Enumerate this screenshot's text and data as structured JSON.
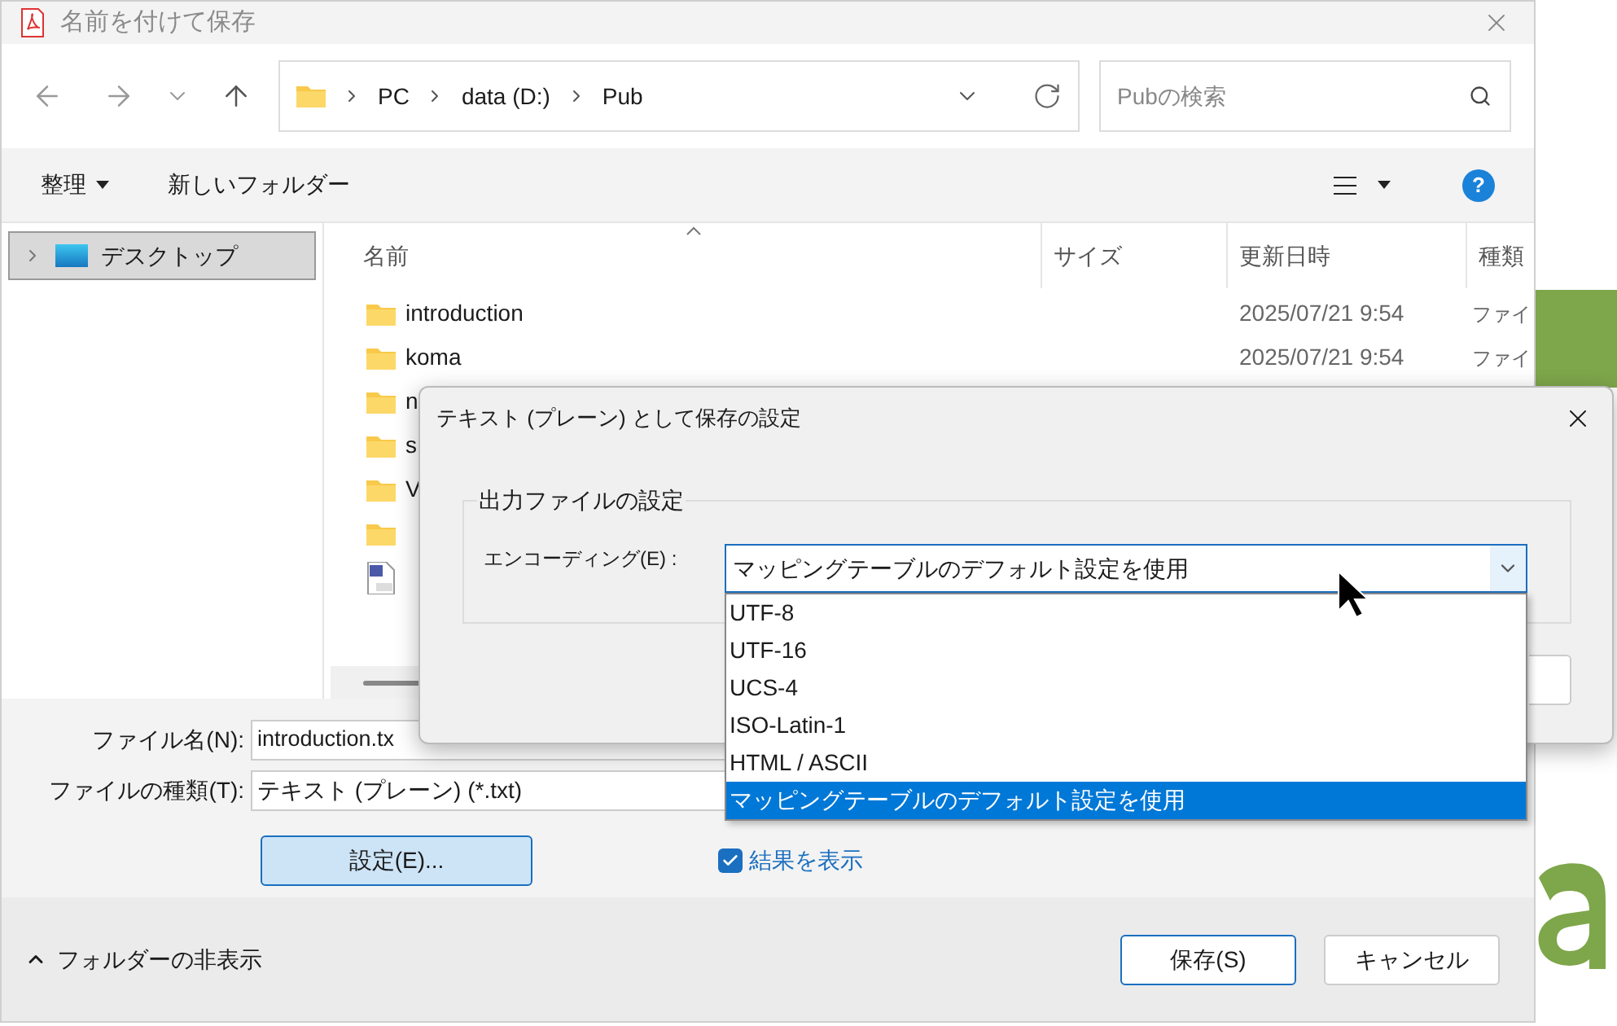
{
  "window": {
    "title": "名前を付けて保存"
  },
  "address": {
    "crumbs": [
      "PC",
      "data (D:)",
      "Pub"
    ]
  },
  "search": {
    "placeholder": "Pubの検索"
  },
  "toolbar": {
    "organize": "整理",
    "new_folder": "新しいフォルダー",
    "help": "?"
  },
  "sidebar": {
    "items": [
      {
        "label": "デスクトップ",
        "selected": true
      }
    ]
  },
  "table": {
    "columns": [
      "名前",
      "サイズ",
      "更新日時",
      "種類"
    ],
    "rows": [
      {
        "kind": "folder",
        "name": "introduction",
        "date": "2025/07/21 9:54",
        "type": "ファイ"
      },
      {
        "kind": "folder",
        "name": "koma",
        "date": "2025/07/21 9:54",
        "type": "ファイ"
      },
      {
        "kind": "folder",
        "name": "n"
      },
      {
        "kind": "folder",
        "name": "s"
      },
      {
        "kind": "folder",
        "name": "V"
      },
      {
        "kind": "folder"
      },
      {
        "kind": "file"
      }
    ]
  },
  "filename": {
    "label": "ファイル名(N):",
    "value": "introduction.tx"
  },
  "filetype": {
    "label": "ファイルの種類(T):",
    "value": "テキスト (プレーン) (*.txt)"
  },
  "settings_button": "設定(E)...",
  "show_result": {
    "label": "結果を表示",
    "checked": true
  },
  "hide_folders": "フォルダーの非表示",
  "buttons": [
    "保存(S)",
    "キャンセル"
  ],
  "dialog": {
    "title": "テキスト (プレーン) として保存の設定",
    "group": "出力ファイルの設定",
    "encoding_label": "エンコーディング(E) :",
    "encoding_value": "マッピングテーブルのデフォルト設定を使用",
    "options": [
      {
        "label": "UTF-8",
        "selected": false
      },
      {
        "label": "UTF-16",
        "selected": false
      },
      {
        "label": "UCS-4",
        "selected": false
      },
      {
        "label": "ISO-Latin-1",
        "selected": false
      },
      {
        "label": "HTML / ASCII",
        "selected": false
      },
      {
        "label": "マッピングテーブルのデフォルト設定を使用",
        "selected": true
      }
    ]
  }
}
